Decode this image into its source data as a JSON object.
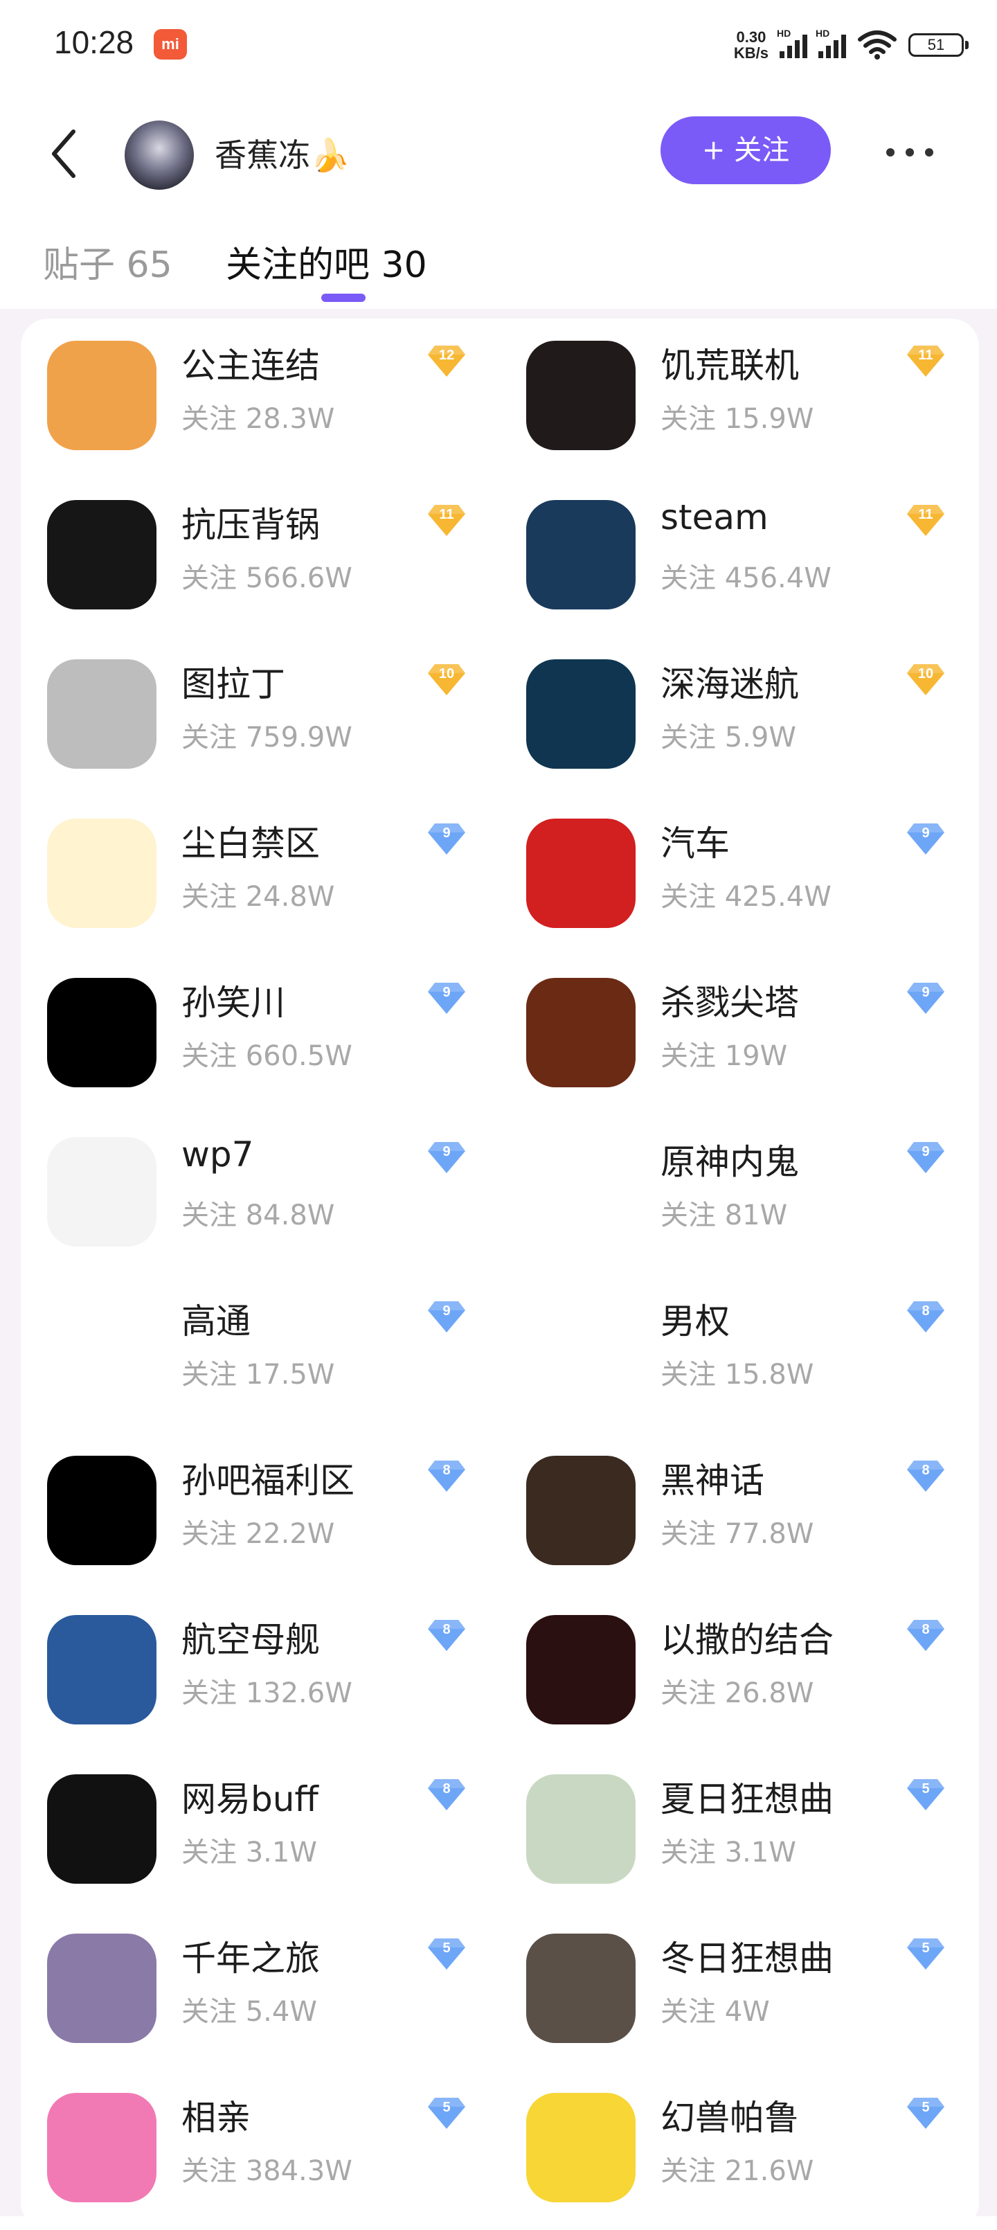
{
  "status_bar": {
    "time": "10:28",
    "mi_label": "mi",
    "net_speed_value": "0.30",
    "net_speed_unit": "KB/s",
    "hd_label": "HD",
    "battery": "51"
  },
  "header": {
    "username": "香蕉冻🍌",
    "follow_button": "+ 关注"
  },
  "tabs": [
    {
      "label": "贴子 65"
    },
    {
      "label": "关注的吧 30"
    }
  ],
  "colors": {
    "accent": "#7b5bf7",
    "badge_gold": "#f7b733",
    "badge_blue": "#6ea6f7"
  },
  "bars": [
    {
      "name": "公主连结",
      "followers": "关注 28.3W",
      "level": "12",
      "tier": "gold",
      "icon": "anime-girl-icon",
      "icon_bg": "#f0a24a"
    },
    {
      "name": "饥荒联机",
      "followers": "关注 15.9W",
      "level": "11",
      "tier": "gold",
      "icon": "dont-starve-icon",
      "icon_bg": "#201a1a"
    },
    {
      "name": "抗压背锅",
      "followers": "关注 566.6W",
      "level": "11",
      "tier": "gold",
      "icon": "calligraphy-icon",
      "icon_bg": "#161616"
    },
    {
      "name": "steam",
      "followers": "关注 456.4W",
      "level": "11",
      "tier": "gold",
      "icon": "steam-logo-icon",
      "icon_bg": "#1a3a5c"
    },
    {
      "name": "图拉丁",
      "followers": "关注 759.9W",
      "level": "10",
      "tier": "gold",
      "icon": "grey-box-icon",
      "icon_bg": "#bdbdbd"
    },
    {
      "name": "深海迷航",
      "followers": "关注 5.9W",
      "level": "10",
      "tier": "gold",
      "icon": "ocean-leviathan-icon",
      "icon_bg": "#0f3550"
    },
    {
      "name": "尘白禁区",
      "followers": "关注 24.8W",
      "level": "9",
      "tier": "blue",
      "icon": "chibi-girl-icon",
      "icon_bg": "#fff3d0"
    },
    {
      "name": "汽车",
      "followers": "关注 425.4W",
      "level": "9",
      "tier": "blue",
      "icon": "red-sportscar-icon",
      "icon_bg": "#d21f1f"
    },
    {
      "name": "孙笑川",
      "followers": "关注 660.5W",
      "level": "9",
      "tier": "blue",
      "icon": "hand-icon",
      "icon_bg": "#000000"
    },
    {
      "name": "杀戮尖塔",
      "followers": "关注 19W",
      "level": "9",
      "tier": "blue",
      "icon": "slay-the-spire-icon",
      "icon_bg": "#6b2a14"
    },
    {
      "name": "wp7",
      "followers": "关注 84.8W",
      "level": "9",
      "tier": "blue",
      "icon": "windows-phone-icon",
      "icon_bg": "#f4f4f4"
    },
    {
      "name": "原神内鬼",
      "followers": "关注 81W",
      "level": "9",
      "tier": "blue",
      "icon": "thumbs-up-icon",
      "icon_bg": "#ffffff"
    },
    {
      "name": "高通",
      "followers": "关注 17.5W",
      "level": "9",
      "tier": "blue",
      "icon": "qualcomm-logo-icon",
      "icon_bg": "#ffffff"
    },
    {
      "name": "男权",
      "followers": "关注 15.8W",
      "level": "8",
      "tier": "blue",
      "icon": "yellow-sign-icon",
      "icon_bg": "#ffffff"
    },
    {
      "name": "孙吧福利区",
      "followers": "关注 22.2W",
      "level": "8",
      "tier": "blue",
      "icon": "hand-icon",
      "icon_bg": "#000000"
    },
    {
      "name": "黑神话",
      "followers": "关注 77.8W",
      "level": "8",
      "tier": "blue",
      "icon": "monkey-king-icon",
      "icon_bg": "#3a2a20"
    },
    {
      "name": "航空母舰",
      "followers": "关注 132.6W",
      "level": "8",
      "tier": "blue",
      "icon": "aircraft-carrier-icon",
      "icon_bg": "#2a5a9c"
    },
    {
      "name": "以撒的结合",
      "followers": "关注 26.8W",
      "level": "8",
      "tier": "blue",
      "icon": "isaac-icon",
      "icon_bg": "#2a1010"
    },
    {
      "name": "网易buff",
      "followers": "关注 3.1W",
      "level": "8",
      "tier": "blue",
      "icon": "buff-logo-icon",
      "icon_bg": "#111111"
    },
    {
      "name": "夏日狂想曲",
      "followers": "关注 3.1W",
      "level": "5",
      "tier": "blue",
      "icon": "summer-girls-icon",
      "icon_bg": "#c9d8c2"
    },
    {
      "name": "千年之旅",
      "followers": "关注 5.4W",
      "level": "5",
      "tier": "blue",
      "icon": "anime-girl-icon",
      "icon_bg": "#8a7aa8"
    },
    {
      "name": "冬日狂想曲",
      "followers": "关注 4W",
      "level": "5",
      "tier": "blue",
      "icon": "winter-girl-icon",
      "icon_bg": "#5a5048"
    },
    {
      "name": "相亲",
      "followers": "关注 384.3W",
      "level": "5",
      "tier": "blue",
      "icon": "hearts-icon",
      "icon_bg": "#f27ab4"
    },
    {
      "name": "幻兽帕鲁",
      "followers": "关注 21.6W",
      "level": "5",
      "tier": "blue",
      "icon": "palworld-creature-icon",
      "icon_bg": "#f7d636"
    }
  ]
}
